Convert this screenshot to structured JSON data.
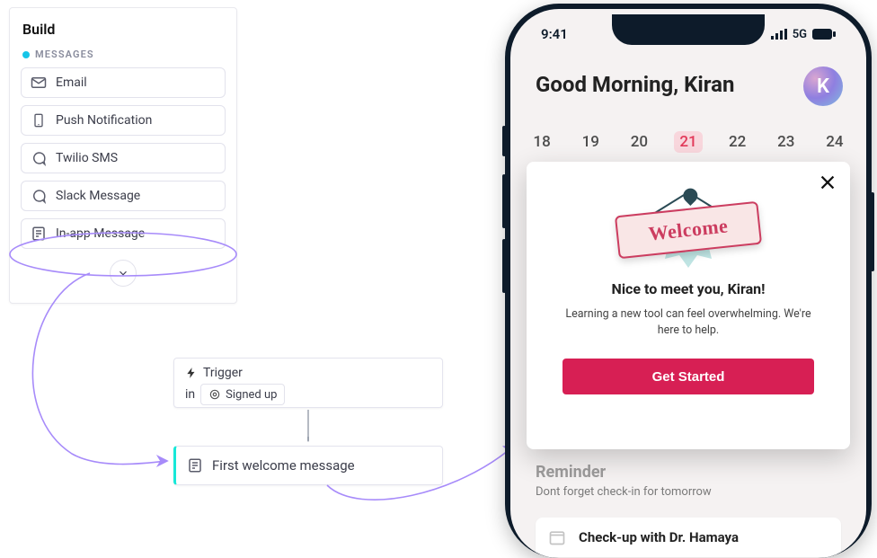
{
  "build": {
    "title": "Build",
    "section_label": "MESSAGES",
    "items": [
      {
        "icon": "envelope-icon",
        "label": "Email"
      },
      {
        "icon": "phone-icon",
        "label": "Push Notification"
      },
      {
        "icon": "chat-icon",
        "label": "Twilio SMS"
      },
      {
        "icon": "chat-icon",
        "label": "Slack Message"
      },
      {
        "icon": "doc-icon",
        "label": "In-app Message"
      }
    ]
  },
  "trigger": {
    "label": "Trigger",
    "prefix": "in",
    "chip": "Signed up"
  },
  "node": {
    "label": "First welcome message"
  },
  "phone": {
    "status": {
      "time": "9:41",
      "network": "5G"
    },
    "greeting": "Good Morning, Kiran",
    "avatar_initial": "K",
    "dates": [
      "18",
      "19",
      "20",
      "21",
      "22",
      "23",
      "24"
    ],
    "selected_date_index": 3,
    "reminder_title": "Reminder",
    "reminder_sub": "Dont forget check-in for tomorrow",
    "checkup": "Check-up with Dr. Hamaya"
  },
  "overlay": {
    "sign_text": "Welcome",
    "title": "Nice to meet you, Kiran!",
    "body": "Learning a new tool can feel overwhelming. We're here to help.",
    "cta": "Get Started"
  }
}
